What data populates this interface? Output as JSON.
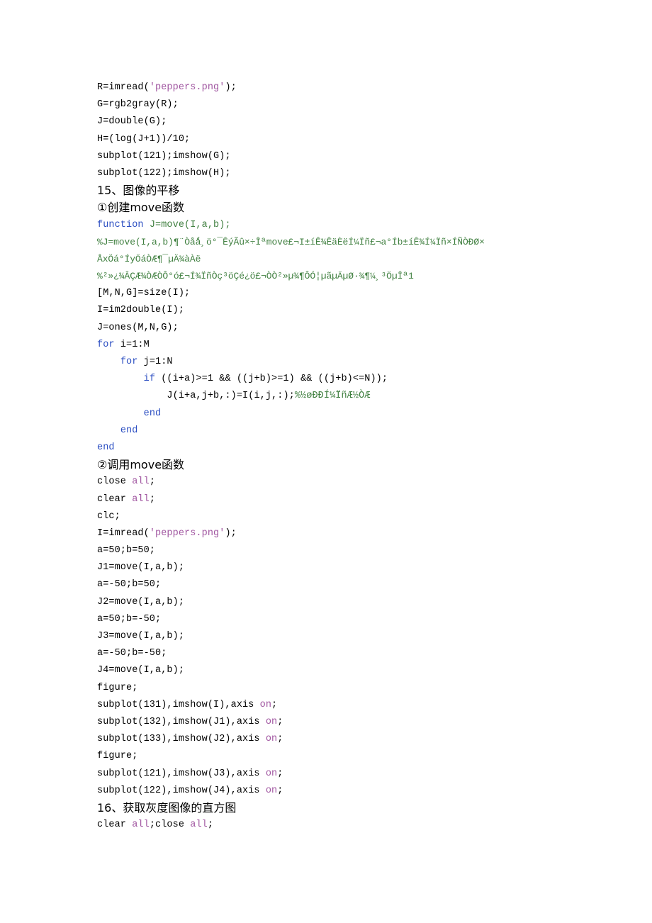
{
  "document": {
    "type": "matlab-tutorial-page",
    "background_color": "#ffffff",
    "text_color": "#000000",
    "keyword_color": "#2b4ec2",
    "string_color": "#a055a0",
    "comment_color": "#3f7f3f"
  },
  "lines": [
    {
      "id": "l1",
      "kind": "code",
      "indent": 0,
      "tokens": [
        {
          "t": "R=imread(",
          "c": "plain"
        },
        {
          "t": "'peppers.png'",
          "c": "str"
        },
        {
          "t": ");",
          "c": "plain"
        }
      ]
    },
    {
      "id": "l2",
      "kind": "code",
      "indent": 0,
      "tokens": [
        {
          "t": "G=rgb2gray(R);",
          "c": "plain"
        }
      ]
    },
    {
      "id": "l3",
      "kind": "code",
      "indent": 0,
      "tokens": [
        {
          "t": "J=double(G);",
          "c": "plain"
        }
      ]
    },
    {
      "id": "l4",
      "kind": "code",
      "indent": 0,
      "tokens": [
        {
          "t": "H=(log(J+1))/10;",
          "c": "plain"
        }
      ]
    },
    {
      "id": "l5",
      "kind": "code",
      "indent": 0,
      "tokens": [
        {
          "t": "subplot(121);imshow(G);",
          "c": "plain"
        }
      ]
    },
    {
      "id": "l6",
      "kind": "code",
      "indent": 0,
      "tokens": [
        {
          "t": "subplot(122);imshow(H);",
          "c": "plain"
        }
      ]
    },
    {
      "id": "l7",
      "kind": "heading",
      "indent": 0,
      "tokens": [
        {
          "t": "15、图像的平移",
          "c": "cjk"
        }
      ]
    },
    {
      "id": "l8",
      "kind": "heading",
      "indent": 0,
      "tokens": [
        {
          "t": "①创建move函数",
          "c": "cjk"
        }
      ]
    },
    {
      "id": "l9",
      "kind": "code",
      "indent": 0,
      "tokens": [
        {
          "t": "function ",
          "c": "kw"
        },
        {
          "t": "J=move(I,a,b);",
          "c": "cmt"
        }
      ]
    },
    {
      "id": "l10",
      "kind": "mojibake",
      "indent": 0,
      "tokens": [
        {
          "t": "%J=move(I,a,b)¶¨Òåǻ¸ö°¯ÊýÃû×÷Îªmove£¬I±íÊ¾ÊäÈëÍ¼Ïñ£¬a°Íb±íÊ¾Í¼Ïñ×ÍÑÒÐØ×",
          "c": "cmt"
        }
      ]
    },
    {
      "id": "l11",
      "kind": "mojibake",
      "indent": 0,
      "tokens": [
        {
          "t": "ÅxÖá°ÍyÖáÒÆ¶¯µÄ¾àÀë",
          "c": "cmt"
        }
      ]
    },
    {
      "id": "l12",
      "kind": "mojibake",
      "indent": 0,
      "tokens": [
        {
          "t": "%²»¿¾ÂÇÆ¾ÒÆÒÔ°ó£¬Í¾ÏñÒç³öÇé¿ö£¬ÒÒ²»µ¾¶ÔÓ¦µãµÄµØ·¾¶¼¸³ÖµÎª1",
          "c": "cmt"
        }
      ]
    },
    {
      "id": "l13",
      "kind": "code",
      "indent": 0,
      "tokens": [
        {
          "t": "[M,N,G]=size(I);",
          "c": "plain"
        }
      ]
    },
    {
      "id": "l14",
      "kind": "code",
      "indent": 0,
      "tokens": [
        {
          "t": "I=im2double(I);",
          "c": "plain"
        }
      ]
    },
    {
      "id": "l15",
      "kind": "code",
      "indent": 0,
      "tokens": [
        {
          "t": "J=ones(M,N,G);",
          "c": "plain"
        }
      ]
    },
    {
      "id": "l16",
      "kind": "code",
      "indent": 0,
      "tokens": [
        {
          "t": "for ",
          "c": "kw"
        },
        {
          "t": "i=1:M",
          "c": "plain"
        }
      ]
    },
    {
      "id": "l17",
      "kind": "code",
      "indent": 1,
      "tokens": [
        {
          "t": "for ",
          "c": "kw"
        },
        {
          "t": "j=1:N",
          "c": "plain"
        }
      ]
    },
    {
      "id": "l18",
      "kind": "code",
      "indent": 2,
      "tokens": [
        {
          "t": "if ",
          "c": "kw"
        },
        {
          "t": "((i+a)>=1 && ((j+b)>=1) && ((j+b)<=N));",
          "c": "plain"
        }
      ]
    },
    {
      "id": "l19",
      "kind": "code",
      "indent": 3,
      "tokens": [
        {
          "t": "J(i+a,j+b,:)=I(i,j,:);",
          "c": "plain"
        },
        {
          "t": "%½øÐÐÍ¼ÏñÆ½ÒÆ",
          "c": "cmt"
        }
      ]
    },
    {
      "id": "l20",
      "kind": "code",
      "indent": 2,
      "tokens": [
        {
          "t": "end",
          "c": "kw"
        }
      ]
    },
    {
      "id": "l21",
      "kind": "code",
      "indent": 1,
      "tokens": [
        {
          "t": "end",
          "c": "kw"
        }
      ]
    },
    {
      "id": "l22",
      "kind": "code",
      "indent": 0,
      "tokens": [
        {
          "t": "end",
          "c": "kw"
        }
      ]
    },
    {
      "id": "l23",
      "kind": "heading",
      "indent": 0,
      "tokens": [
        {
          "t": "②调用move函数",
          "c": "cjk"
        }
      ]
    },
    {
      "id": "l24",
      "kind": "code",
      "indent": 0,
      "tokens": [
        {
          "t": "close ",
          "c": "plain"
        },
        {
          "t": "all",
          "c": "str"
        },
        {
          "t": ";",
          "c": "plain"
        }
      ]
    },
    {
      "id": "l25",
      "kind": "code",
      "indent": 0,
      "tokens": [
        {
          "t": "clear ",
          "c": "plain"
        },
        {
          "t": "all",
          "c": "str"
        },
        {
          "t": ";",
          "c": "plain"
        }
      ]
    },
    {
      "id": "l26",
      "kind": "code",
      "indent": 0,
      "tokens": [
        {
          "t": "clc;",
          "c": "plain"
        }
      ]
    },
    {
      "id": "l27",
      "kind": "code",
      "indent": 0,
      "tokens": [
        {
          "t": "I=imread(",
          "c": "plain"
        },
        {
          "t": "'peppers.png'",
          "c": "str"
        },
        {
          "t": ");",
          "c": "plain"
        }
      ]
    },
    {
      "id": "l28",
      "kind": "code",
      "indent": 0,
      "tokens": [
        {
          "t": "a=50;b=50;",
          "c": "plain"
        }
      ]
    },
    {
      "id": "l29",
      "kind": "code",
      "indent": 0,
      "tokens": [
        {
          "t": "J1=move(I,a,b);",
          "c": "plain"
        }
      ]
    },
    {
      "id": "l30",
      "kind": "code",
      "indent": 0,
      "tokens": [
        {
          "t": "a=-50;b=50;",
          "c": "plain"
        }
      ]
    },
    {
      "id": "l31",
      "kind": "code",
      "indent": 0,
      "tokens": [
        {
          "t": "J2=move(I,a,b);",
          "c": "plain"
        }
      ]
    },
    {
      "id": "l32",
      "kind": "code",
      "indent": 0,
      "tokens": [
        {
          "t": "a=50;b=-50;",
          "c": "plain"
        }
      ]
    },
    {
      "id": "l33",
      "kind": "code",
      "indent": 0,
      "tokens": [
        {
          "t": "J3=move(I,a,b);",
          "c": "plain"
        }
      ]
    },
    {
      "id": "l34",
      "kind": "code",
      "indent": 0,
      "tokens": [
        {
          "t": "a=-50;b=-50;",
          "c": "plain"
        }
      ]
    },
    {
      "id": "l35",
      "kind": "code",
      "indent": 0,
      "tokens": [
        {
          "t": "J4=move(I,a,b);",
          "c": "plain"
        }
      ]
    },
    {
      "id": "l36",
      "kind": "code",
      "indent": 0,
      "tokens": [
        {
          "t": "figure;",
          "c": "plain"
        }
      ]
    },
    {
      "id": "l37",
      "kind": "code",
      "indent": 0,
      "tokens": [
        {
          "t": "subplot(131),imshow(I),axis ",
          "c": "plain"
        },
        {
          "t": "on",
          "c": "str"
        },
        {
          "t": ";",
          "c": "plain"
        }
      ]
    },
    {
      "id": "l38",
      "kind": "code",
      "indent": 0,
      "tokens": [
        {
          "t": "subplot(132),imshow(J1),axis ",
          "c": "plain"
        },
        {
          "t": "on",
          "c": "str"
        },
        {
          "t": ";",
          "c": "plain"
        }
      ]
    },
    {
      "id": "l39",
      "kind": "code",
      "indent": 0,
      "tokens": [
        {
          "t": "subplot(133),imshow(J2),axis ",
          "c": "plain"
        },
        {
          "t": "on",
          "c": "str"
        },
        {
          "t": ";",
          "c": "plain"
        }
      ]
    },
    {
      "id": "l40",
      "kind": "code",
      "indent": 0,
      "tokens": [
        {
          "t": "figure;",
          "c": "plain"
        }
      ]
    },
    {
      "id": "l41",
      "kind": "code",
      "indent": 0,
      "tokens": [
        {
          "t": "subplot(121),imshow(J3),axis ",
          "c": "plain"
        },
        {
          "t": "on",
          "c": "str"
        },
        {
          "t": ";",
          "c": "plain"
        }
      ]
    },
    {
      "id": "l42",
      "kind": "code",
      "indent": 0,
      "tokens": [
        {
          "t": "subplot(122),imshow(J4),axis ",
          "c": "plain"
        },
        {
          "t": "on",
          "c": "str"
        },
        {
          "t": ";",
          "c": "plain"
        }
      ]
    },
    {
      "id": "l43",
      "kind": "heading",
      "indent": 0,
      "tokens": [
        {
          "t": "16、获取灰度图像的直方图",
          "c": "cjk"
        }
      ]
    },
    {
      "id": "l44",
      "kind": "code",
      "indent": 0,
      "tokens": [
        {
          "t": "clear ",
          "c": "plain"
        },
        {
          "t": "all",
          "c": "str"
        },
        {
          "t": ";close ",
          "c": "plain"
        },
        {
          "t": "all",
          "c": "str"
        },
        {
          "t": ";",
          "c": "plain"
        }
      ]
    }
  ]
}
